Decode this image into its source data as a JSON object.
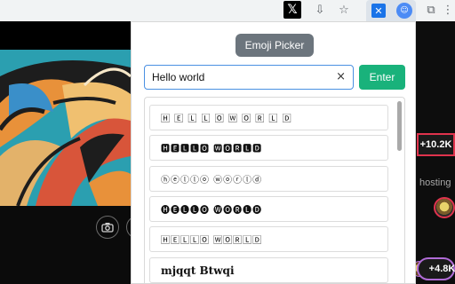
{
  "browser": {
    "toolbar_icons": {
      "x": "𝕏",
      "install": "⇩",
      "star": "☆",
      "ext_twitter": "✕",
      "ext_active": "☺",
      "puzzle": "⧉",
      "more": "⋮"
    }
  },
  "popup": {
    "title": "Emoji Picker",
    "search": {
      "value": "Hello world",
      "clear_icon": "×"
    },
    "enter_label": "Enter",
    "results": [
      "🄷 🄴 🄻 🄻 🄾   🅆 🄾 🅁 🄻 🄳",
      "🅷🅴🅻🅻🅾 🆆🅾🆁🅻🅳",
      "ⓗⓔⓛⓛⓞ ⓦⓞⓡⓛⓓ",
      "🅗🅔🅛🅛🅞 🅦🅞🅡🅛🅓",
      "🄷🄴🄻🄻🄾 🅆🄾🅁🄻🄳",
      "mjqqt Btwqi"
    ]
  },
  "page": {
    "badge_top": "+10.2K",
    "side_text": "hosting",
    "badge_bottom": "+4.8K"
  },
  "colors": {
    "enter": "#19b27b",
    "title_chip": "#6c757d",
    "focus_border": "#4a90e2"
  }
}
